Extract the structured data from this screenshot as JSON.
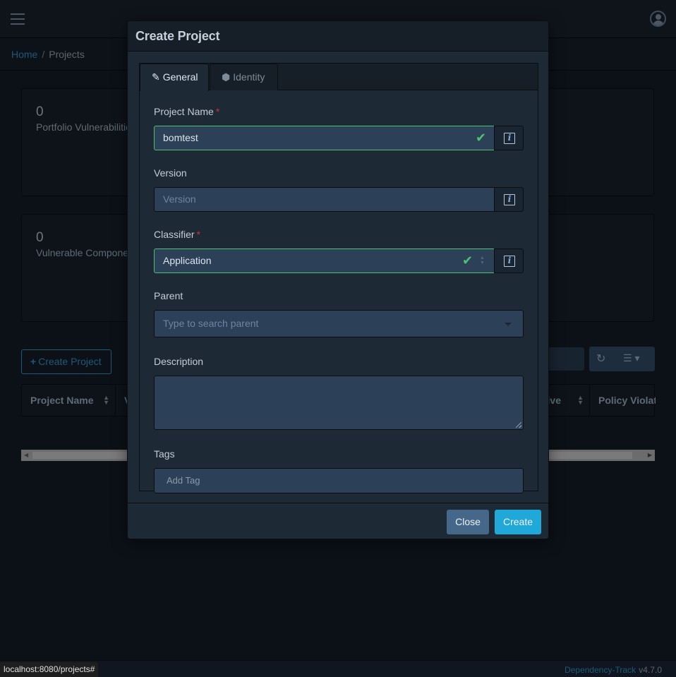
{
  "app": {
    "breadcrumb": {
      "home": "Home",
      "separator": "/",
      "current": "Projects"
    },
    "icons": {
      "menu": "hamburger-icon",
      "user": "user-circle-icon"
    }
  },
  "cards": [
    {
      "value": "0",
      "label": "Portfolio Vulnerabilities"
    },
    {
      "value": "0",
      "label": "Vulnerable Components"
    }
  ],
  "toolbar": {
    "create_project_label": "Create Project",
    "create_project_icon": "+",
    "refresh_icon": "↻",
    "columns_icon": "☰ ▾"
  },
  "table": {
    "columns": [
      "Project Name",
      "V",
      "tive",
      "Policy Violat"
    ]
  },
  "modal": {
    "title": "Create Project",
    "tabs": [
      {
        "label": "General",
        "icon": "✎",
        "active": true
      },
      {
        "label": "Identity",
        "icon": "⬢",
        "active": false
      }
    ],
    "fields": {
      "project_name": {
        "label": "Project Name",
        "required": "*",
        "value": "bomtest",
        "valid": true
      },
      "version": {
        "label": "Version",
        "placeholder": "Version",
        "value": ""
      },
      "classifier": {
        "label": "Classifier",
        "required": "*",
        "value": "Application",
        "valid": true
      },
      "parent": {
        "label": "Parent",
        "placeholder": "Type to search parent"
      },
      "description": {
        "label": "Description",
        "value": ""
      },
      "tags": {
        "label": "Tags",
        "placeholder": "Add Tag"
      }
    },
    "info_icon_glyph": "i",
    "check_glyph": "✔",
    "buttons": {
      "close": "Close",
      "create": "Create"
    }
  },
  "footer": {
    "brand": "Dependency-Track",
    "version": "v4.7.0"
  },
  "status_bar": {
    "url": "localhost:8080/projects#"
  }
}
